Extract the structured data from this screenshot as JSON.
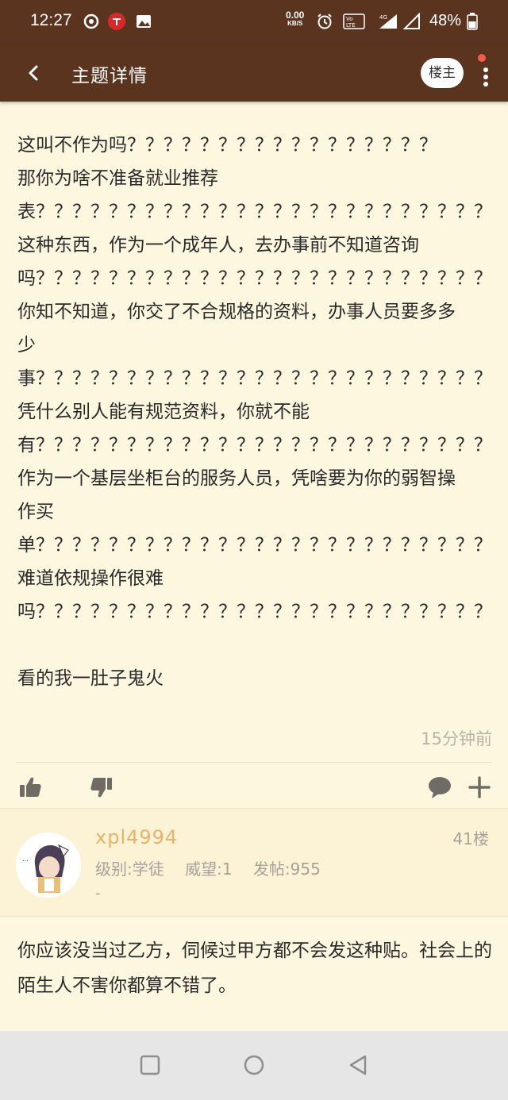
{
  "status_bar": {
    "time": "12:27",
    "net_speed_value": "0.00",
    "net_speed_unit": "KB/S",
    "battery": "48%",
    "icons": [
      "netease-icon",
      "notification-red-icon",
      "image-icon",
      "alarm-icon",
      "volte-icon",
      "signal-4g-icon",
      "signal-icon",
      "battery-icon"
    ]
  },
  "app_bar": {
    "title": "主题详情",
    "louzhu_label": "楼主"
  },
  "post": {
    "text": "这叫不作为吗？？？？？？？？？？？？？？？？？\n那你为啥不准备就业推荐\n表？？？？？？？？？？？？？？？？？？？？？？？？？\n这种东西，作为一个成年人，去办事前不知道咨询\n吗？？？？？？？？？？？？？？？？？？？？？？？？？\n你知不知道，你交了不合规格的资料，办事人员要多多\n少\n事？？？？？？？？？？？？？？？？？？？？？？？？？\n凭什么别人能有规范资料，你就不能\n有？？？？？？？？？？？？？？？？？？？？？？？？？\n作为一个基层坐柜台的服务人员，凭啥要为你的弱智操\n作买\n单？？？？？？？？？？？？？？？？？？？？？？？？？\n难道依规操作很难\n吗？？？？？？？？？？？？？？？？？？？？？？？？？\n\n看的我一肚子鬼火",
    "time": "15分钟前"
  },
  "reply": {
    "username": "xpl4994",
    "floor": "41楼",
    "level": "级别:学徒",
    "reputation": "威望:1",
    "posts": "发帖:955",
    "signature": "-",
    "text": "你应该没当过乙方，伺候过甲方都不会发这种贴。社会上的陌生人不害你都算不错了。"
  },
  "colors": {
    "header": "#5b3420",
    "background": "#fdf7e0",
    "reply_header": "#fcf2d5",
    "username": "#e9b26a",
    "muted": "#a7a29a"
  }
}
